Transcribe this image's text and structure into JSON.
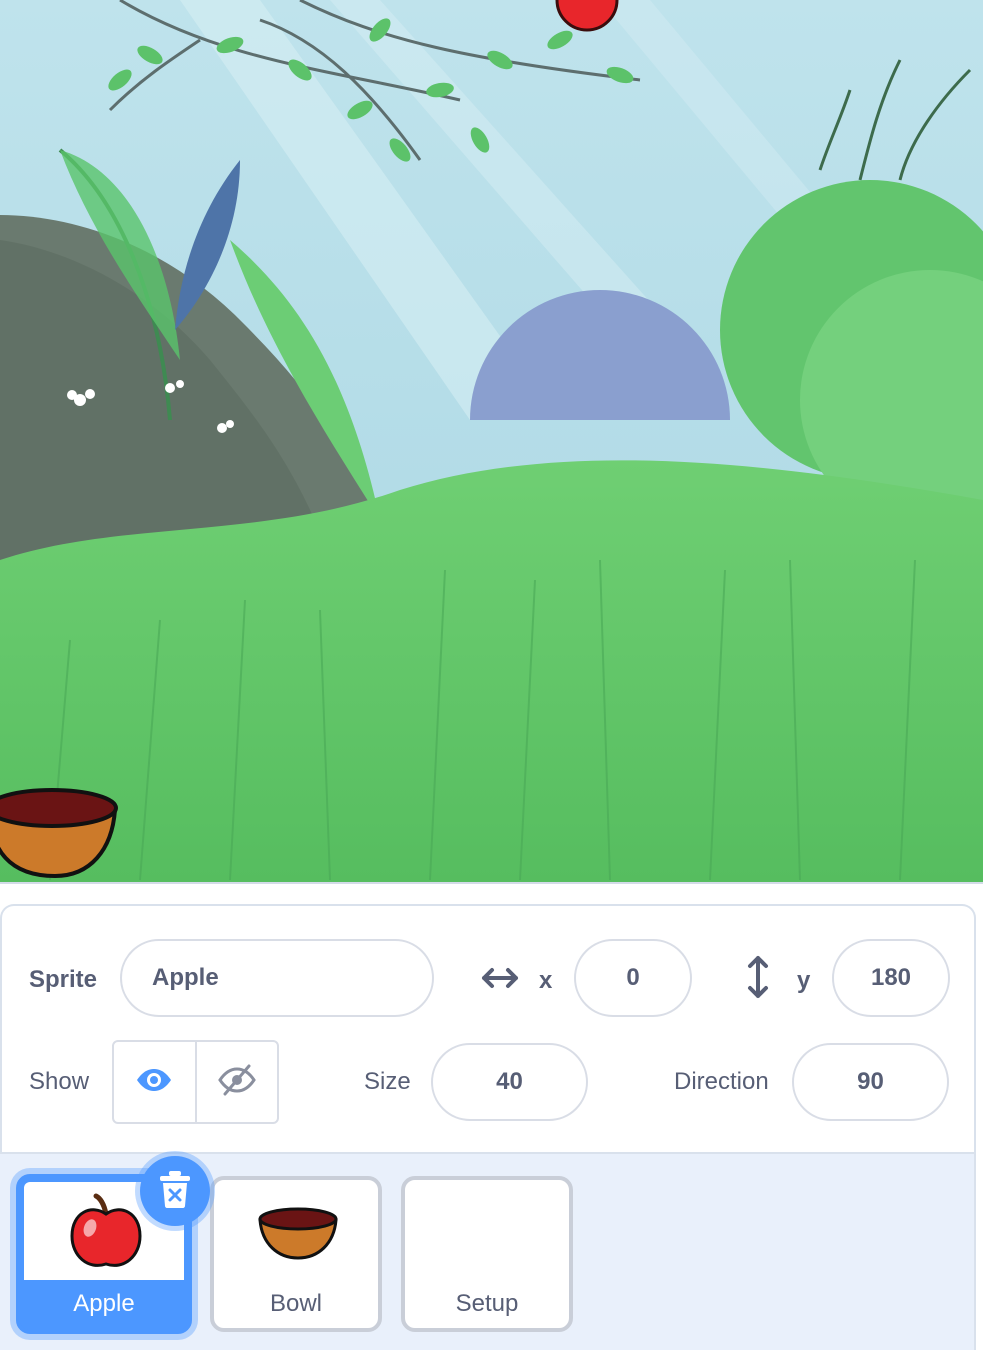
{
  "stage": {
    "backdrop_icon": "forest-backdrop",
    "sprites": [
      "apple",
      "bowl"
    ]
  },
  "sprite_info": {
    "sprite_label": "Sprite",
    "sprite_name": "Apple",
    "x_label": "x",
    "x_value": "0",
    "y_label": "y",
    "y_value": "180",
    "show_label": "Show",
    "size_label": "Size",
    "size_value": "40",
    "direction_label": "Direction",
    "direction_value": "90",
    "show_visible": true
  },
  "sprite_list": {
    "items": [
      {
        "label": "Apple",
        "selected": true,
        "icon": "apple-icon"
      },
      {
        "label": "Bowl",
        "selected": false,
        "icon": "bowl-icon"
      },
      {
        "label": "Setup",
        "selected": false,
        "icon": ""
      }
    ],
    "delete_icon": "trash-icon"
  },
  "colors": {
    "accent": "#4c97ff",
    "text": "#575e75",
    "panel_bg": "#e9f0fb"
  }
}
